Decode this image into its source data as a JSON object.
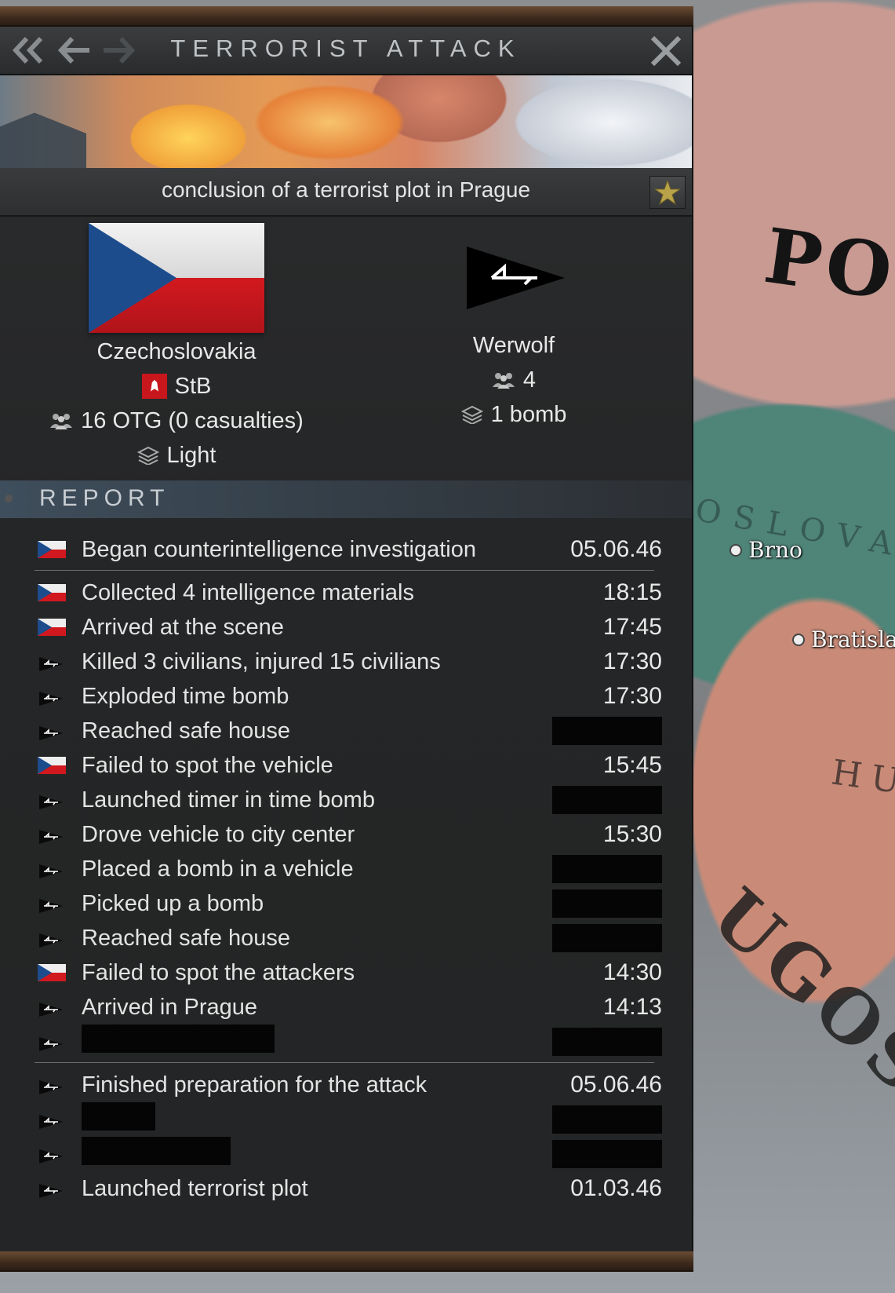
{
  "window": {
    "title": "TERRORIST ATTACK",
    "subtitle": "conclusion of a terrorist plot in Prague"
  },
  "defender": {
    "country": "Czechoslovakia",
    "agency": "StB",
    "forces": "16 OTG (0 casualties)",
    "equipment": "Light",
    "flag": "czechoslovakia-flag"
  },
  "attacker": {
    "group": "Werwolf",
    "members": "4",
    "equipment": "1 bomb",
    "flag": "werwolf-pennant"
  },
  "report": {
    "title": "REPORT",
    "groups": [
      [
        {
          "actor": "cz",
          "text": "Began counterintelligence investigation",
          "time": "05.06.46"
        }
      ],
      [
        {
          "actor": "cz",
          "text": "Collected 4 intelligence materials",
          "time": "18:15"
        },
        {
          "actor": "cz",
          "text": "Arrived at the scene",
          "time": "17:45"
        },
        {
          "actor": "ww",
          "text": "Killed 3 civilians, injured 15 civilians",
          "time": "17:30"
        },
        {
          "actor": "ww",
          "text": "Exploded time bomb",
          "time": "17:30"
        },
        {
          "actor": "ww",
          "text": "Reached safe house",
          "time": null
        },
        {
          "actor": "cz",
          "text": "Failed to spot the vehicle",
          "time": "15:45"
        },
        {
          "actor": "ww",
          "text": "Launched timer in time bomb",
          "time": null
        },
        {
          "actor": "ww",
          "text": "Drove vehicle to city center",
          "time": "15:30"
        },
        {
          "actor": "ww",
          "text": "Placed a bomb in a vehicle",
          "time": null
        },
        {
          "actor": "ww",
          "text": "Picked up a bomb",
          "time": null
        },
        {
          "actor": "ww",
          "text": "Reached safe house",
          "time": null
        },
        {
          "actor": "cz",
          "text": "Failed to spot the attackers",
          "time": "14:30"
        },
        {
          "actor": "ww",
          "text": "Arrived in Prague",
          "time": "14:13"
        },
        {
          "actor": "ww",
          "text": null,
          "time": null,
          "redacted_text_width": "wide"
        }
      ],
      [
        {
          "actor": "ww",
          "text": "Finished preparation for the attack",
          "time": "05.06.46"
        },
        {
          "actor": "ww",
          "text": null,
          "time": null,
          "redacted_text_width": "short"
        },
        {
          "actor": "ww",
          "text": null,
          "time": null,
          "redacted_text_width": "medium"
        },
        {
          "actor": "ww",
          "text": "Launched terrorist plot",
          "time": "01.03.46"
        }
      ]
    ]
  },
  "map": {
    "labels": [
      "PO",
      "OSLOVA",
      "HU",
      "UGOS"
    ],
    "cities": [
      "Brno",
      "Bratisla"
    ]
  },
  "colors": {
    "frame_wood": "#6a4c34",
    "panel_bg": "#2c2d2e",
    "report_header": "#3f4e5c"
  }
}
